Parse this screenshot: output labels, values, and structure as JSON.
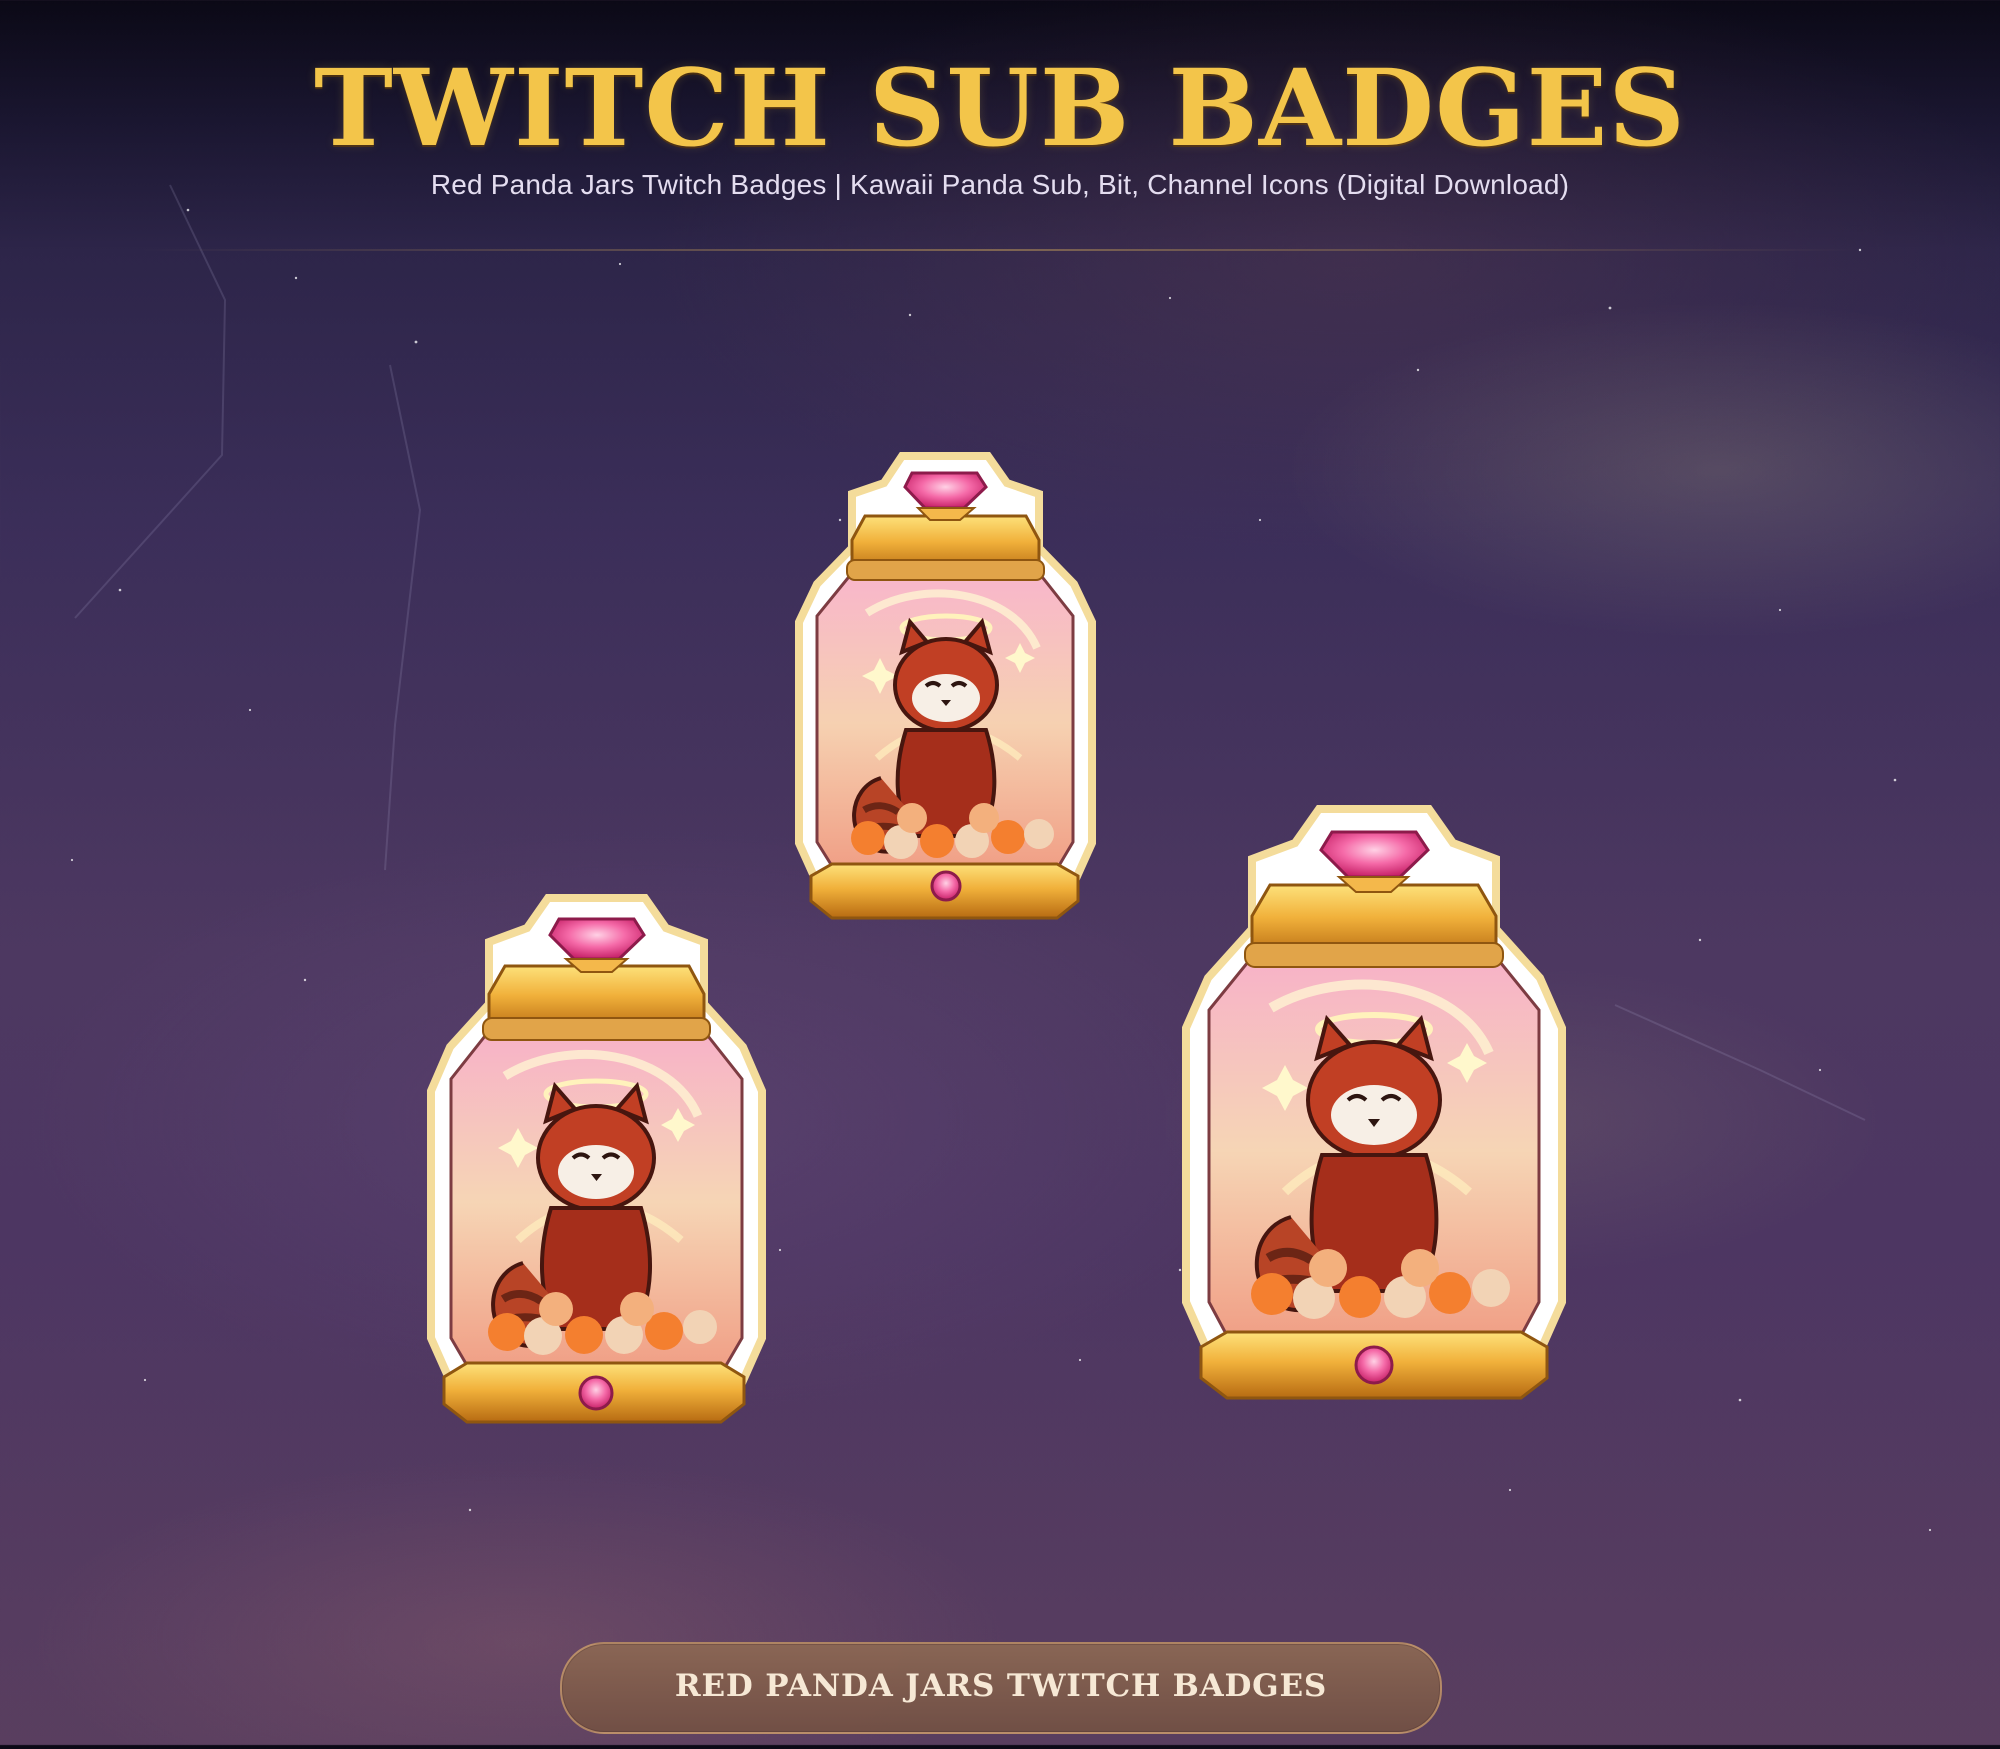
{
  "header": {
    "title": "TWITCH SUB BADGES",
    "subtitle": "Red Panda Jars Twitch Badges | Kawaii Panda Sub, Bit, Channel Icons (Digital Download)"
  },
  "badges": [
    {
      "icon": "red-panda-jar-icon"
    },
    {
      "icon": "red-panda-jar-icon"
    },
    {
      "icon": "red-panda-jar-icon"
    }
  ],
  "footer": {
    "label": "RED PANDA JARS TWITCH BADGES"
  },
  "colors": {
    "title_gold": "#f3c54a",
    "jar_gold": "#e4a62b",
    "gem_pink": "#f05a9a",
    "panda_red": "#b5371f"
  }
}
